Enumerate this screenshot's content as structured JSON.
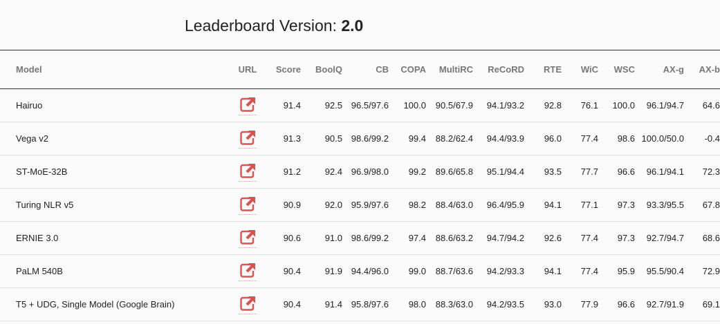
{
  "header": {
    "title_prefix": "Leaderboard Version:",
    "version": "2.0"
  },
  "colors": {
    "link_icon": "#d9534f",
    "header_text": "#777777",
    "row_border": "#e3e3e3"
  },
  "table": {
    "columns": [
      "Model",
      "URL",
      "Score",
      "BoolQ",
      "CB",
      "COPA",
      "MultiRC",
      "ReCoRD",
      "RTE",
      "WiC",
      "WSC",
      "AX-g",
      "AX-b"
    ],
    "url_icon": "external-link-icon",
    "rows": [
      {
        "model": "Hairuo",
        "score": "91.4",
        "boolq": "92.5",
        "cb": "96.5/97.6",
        "copa": "100.0",
        "multirc": "90.5/67.9",
        "record": "94.1/93.2",
        "rte": "92.8",
        "wic": "76.1",
        "wsc": "100.0",
        "axg": "96.1/94.7",
        "axb": "64.6"
      },
      {
        "model": "Vega v2",
        "score": "91.3",
        "boolq": "90.5",
        "cb": "98.6/99.2",
        "copa": "99.4",
        "multirc": "88.2/62.4",
        "record": "94.4/93.9",
        "rte": "96.0",
        "wic": "77.4",
        "wsc": "98.6",
        "axg": "100.0/50.0",
        "axb": "-0.4"
      },
      {
        "model": "ST-MoE-32B",
        "score": "91.2",
        "boolq": "92.4",
        "cb": "96.9/98.0",
        "copa": "99.2",
        "multirc": "89.6/65.8",
        "record": "95.1/94.4",
        "rte": "93.5",
        "wic": "77.7",
        "wsc": "96.6",
        "axg": "96.1/94.1",
        "axb": "72.3"
      },
      {
        "model": "Turing NLR v5",
        "score": "90.9",
        "boolq": "92.0",
        "cb": "95.9/97.6",
        "copa": "98.2",
        "multirc": "88.4/63.0",
        "record": "96.4/95.9",
        "rte": "94.1",
        "wic": "77.1",
        "wsc": "97.3",
        "axg": "93.3/95.5",
        "axb": "67.8"
      },
      {
        "model": "ERNIE 3.0",
        "score": "90.6",
        "boolq": "91.0",
        "cb": "98.6/99.2",
        "copa": "97.4",
        "multirc": "88.6/63.2",
        "record": "94.7/94.2",
        "rte": "92.6",
        "wic": "77.4",
        "wsc": "97.3",
        "axg": "92.7/94.7",
        "axb": "68.6"
      },
      {
        "model": "PaLM 540B",
        "score": "90.4",
        "boolq": "91.9",
        "cb": "94.4/96.0",
        "copa": "99.0",
        "multirc": "88.7/63.6",
        "record": "94.2/93.3",
        "rte": "94.1",
        "wic": "77.4",
        "wsc": "95.9",
        "axg": "95.5/90.4",
        "axb": "72.9"
      },
      {
        "model": "T5 + UDG, Single Model (Google Brain)",
        "score": "90.4",
        "boolq": "91.4",
        "cb": "95.8/97.6",
        "copa": "98.0",
        "multirc": "88.3/63.0",
        "record": "94.2/93.5",
        "rte": "93.0",
        "wic": "77.9",
        "wsc": "96.6",
        "axg": "92.7/91.9",
        "axb": "69.1"
      }
    ]
  }
}
